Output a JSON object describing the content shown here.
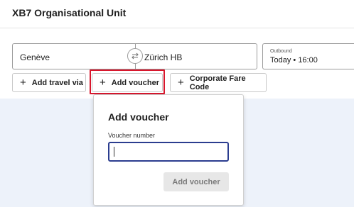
{
  "header": {
    "title": "XB7 Organisational Unit"
  },
  "search": {
    "from": "Genève",
    "to": "Zürich HB",
    "outbound_label": "Outbound",
    "outbound_value": "Today • 16:00",
    "swap_icon": "swap-arrows-icon"
  },
  "chips": {
    "add_travel_via": "Add travel via",
    "add_voucher": "Add voucher",
    "corporate_fare_code": "Corporate Fare Code",
    "plus_symbol": "+"
  },
  "voucher_popover": {
    "title": "Add voucher",
    "field_label": "Voucher number",
    "field_value": "",
    "submit_label": "Add voucher"
  },
  "colors": {
    "highlight": "#d8172d",
    "input_focus": "#2b3d8f",
    "page_background": "#edf2fa"
  }
}
